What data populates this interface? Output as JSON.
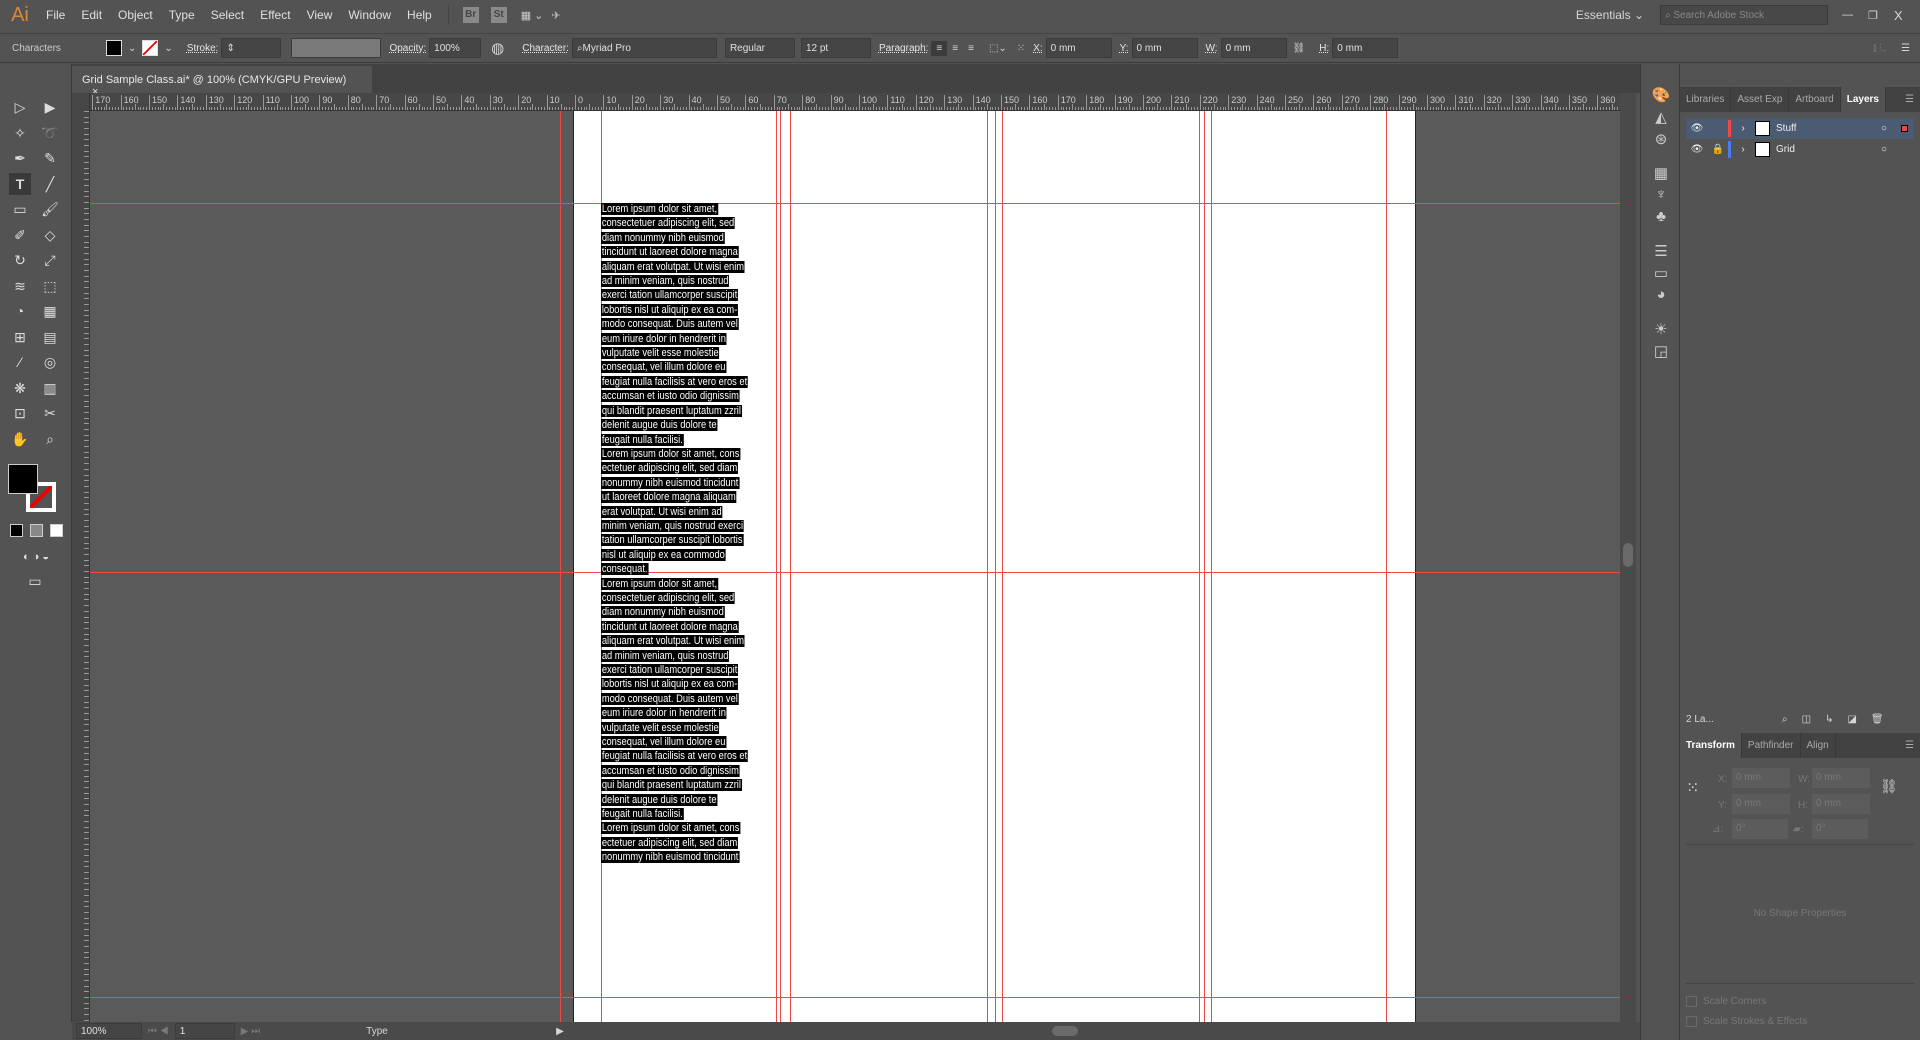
{
  "app": {
    "logo": "Ai",
    "menu": [
      "File",
      "Edit",
      "Object",
      "Type",
      "Select",
      "Effect",
      "View",
      "Window",
      "Help"
    ],
    "bridge": "Br",
    "stock": "St",
    "workspace": "Essentials",
    "search_placeholder": "Search Adobe Stock"
  },
  "control": {
    "panel_name": "Characters",
    "stroke_label": "Stroke:",
    "opacity_label": "Opacity:",
    "opacity": "100%",
    "character_label": "Character:",
    "font": "Myriad Pro",
    "style": "Regular",
    "size": "12 pt",
    "paragraph_label": "Paragraph:",
    "x_label": "X:",
    "x": "0 mm",
    "y_label": "Y:",
    "y": "0 mm",
    "w_label": "W:",
    "w": "0 mm",
    "h_label": "H:",
    "h": "0 mm"
  },
  "document": {
    "tab_title": "Grid Sample Class.ai* @ 100% (CMYK/GPU Preview)",
    "close": "×"
  },
  "ruler": {
    "labels": [
      "170",
      "160",
      "150",
      "140",
      "130",
      "120",
      "110",
      "100",
      "90",
      "80",
      "70",
      "60",
      "50",
      "40",
      "30",
      "20",
      "10",
      "0",
      "10",
      "20",
      "30",
      "40",
      "50",
      "60",
      "70",
      "80",
      "90",
      "100",
      "110",
      "120",
      "130",
      "140",
      "150",
      "160",
      "170",
      "180",
      "190",
      "200",
      "210",
      "220",
      "230",
      "240",
      "250",
      "260",
      "270",
      "280",
      "290",
      "300",
      "310",
      "320",
      "330",
      "340",
      "350",
      "360"
    ]
  },
  "text_lines": [
    "Lorem ipsum dolor sit amet,",
    "consectetuer adipiscing elit, sed",
    "diam nonummy nibh euismod",
    "tincidunt ut laoreet dolore magna",
    "aliquam erat volutpat. Ut wisi enim",
    "ad minim veniam, quis nostrud",
    "exerci tation ullamcorper suscipit",
    "lobortis nisl ut aliquip ex ea com-",
    "modo consequat. Duis autem vel",
    "eum iriure dolor in hendrerit in",
    "vulputate velit esse molestie",
    "consequat, vel illum dolore eu",
    "feugiat nulla facilisis at vero eros et",
    "accumsan et iusto odio dignissim",
    "qui blandit praesent luptatum zzril",
    "delenit augue duis dolore te",
    "feugait nulla facilisi.",
    "Lorem ipsum dolor sit amet, cons",
    "ectetuer adipiscing elit, sed diam",
    "nonummy nibh euismod tincidunt",
    "ut laoreet dolore magna aliquam",
    "erat volutpat. Ut wisi enim ad",
    "minim veniam, quis nostrud exerci",
    "tation ullamcorper suscipit lobortis",
    "nisl ut aliquip ex ea commodo",
    "consequat.",
    "Lorem ipsum dolor sit amet,",
    "consectetuer adipiscing elit, sed",
    "diam nonummy nibh euismod",
    "tincidunt ut laoreet dolore magna",
    "aliquam erat volutpat. Ut wisi enim",
    "ad minim veniam, quis nostrud",
    "exerci tation ullamcorper suscipit",
    "lobortis nisl ut aliquip ex ea com-",
    "modo consequat. Duis autem vel",
    "eum iriure dolor in hendrerit in",
    "vulputate velit esse molestie",
    "consequat, vel illum dolore eu",
    "feugiat nulla facilisis at vero eros et",
    "accumsan et iusto odio dignissim",
    "qui blandit praesent luptatum zzril",
    "delenit augue duis dolore te",
    "feugait nulla facilisi.",
    "Lorem ipsum dolor sit amet, cons",
    "ectetuer adipiscing elit, sed diam",
    "nonummy nibh euismod tincidunt"
  ],
  "status": {
    "zoom": "100%",
    "artboard": "1",
    "tool": "Type"
  },
  "panels": {
    "top_tabs": [
      "Libraries",
      "Asset Exp",
      "Artboard",
      "Layers"
    ],
    "layers": [
      {
        "name": "Stuff",
        "color": "#f04848",
        "locked": false,
        "selected": true
      },
      {
        "name": "Grid",
        "color": "#4a7cf0",
        "locked": true,
        "selected": false
      }
    ],
    "layers_count": "2 La...",
    "bottom_tabs": [
      "Transform",
      "Pathfinder",
      "Align"
    ],
    "transform": {
      "x_label": "X:",
      "x": "0 mm",
      "y_label": "Y:",
      "y": "0 mm",
      "w_label": "W:",
      "w": "0 mm",
      "h_label": "H:",
      "h": "0 mm",
      "angle": "0°",
      "shear": "0°",
      "no_props": "No Shape Properties",
      "scale_corners": "Scale Corners",
      "scale_strokes": "Scale Strokes & Effects"
    }
  },
  "colors": {
    "guide": "#f04848",
    "selection_bg": "#000000",
    "accent": "#d8893a"
  }
}
